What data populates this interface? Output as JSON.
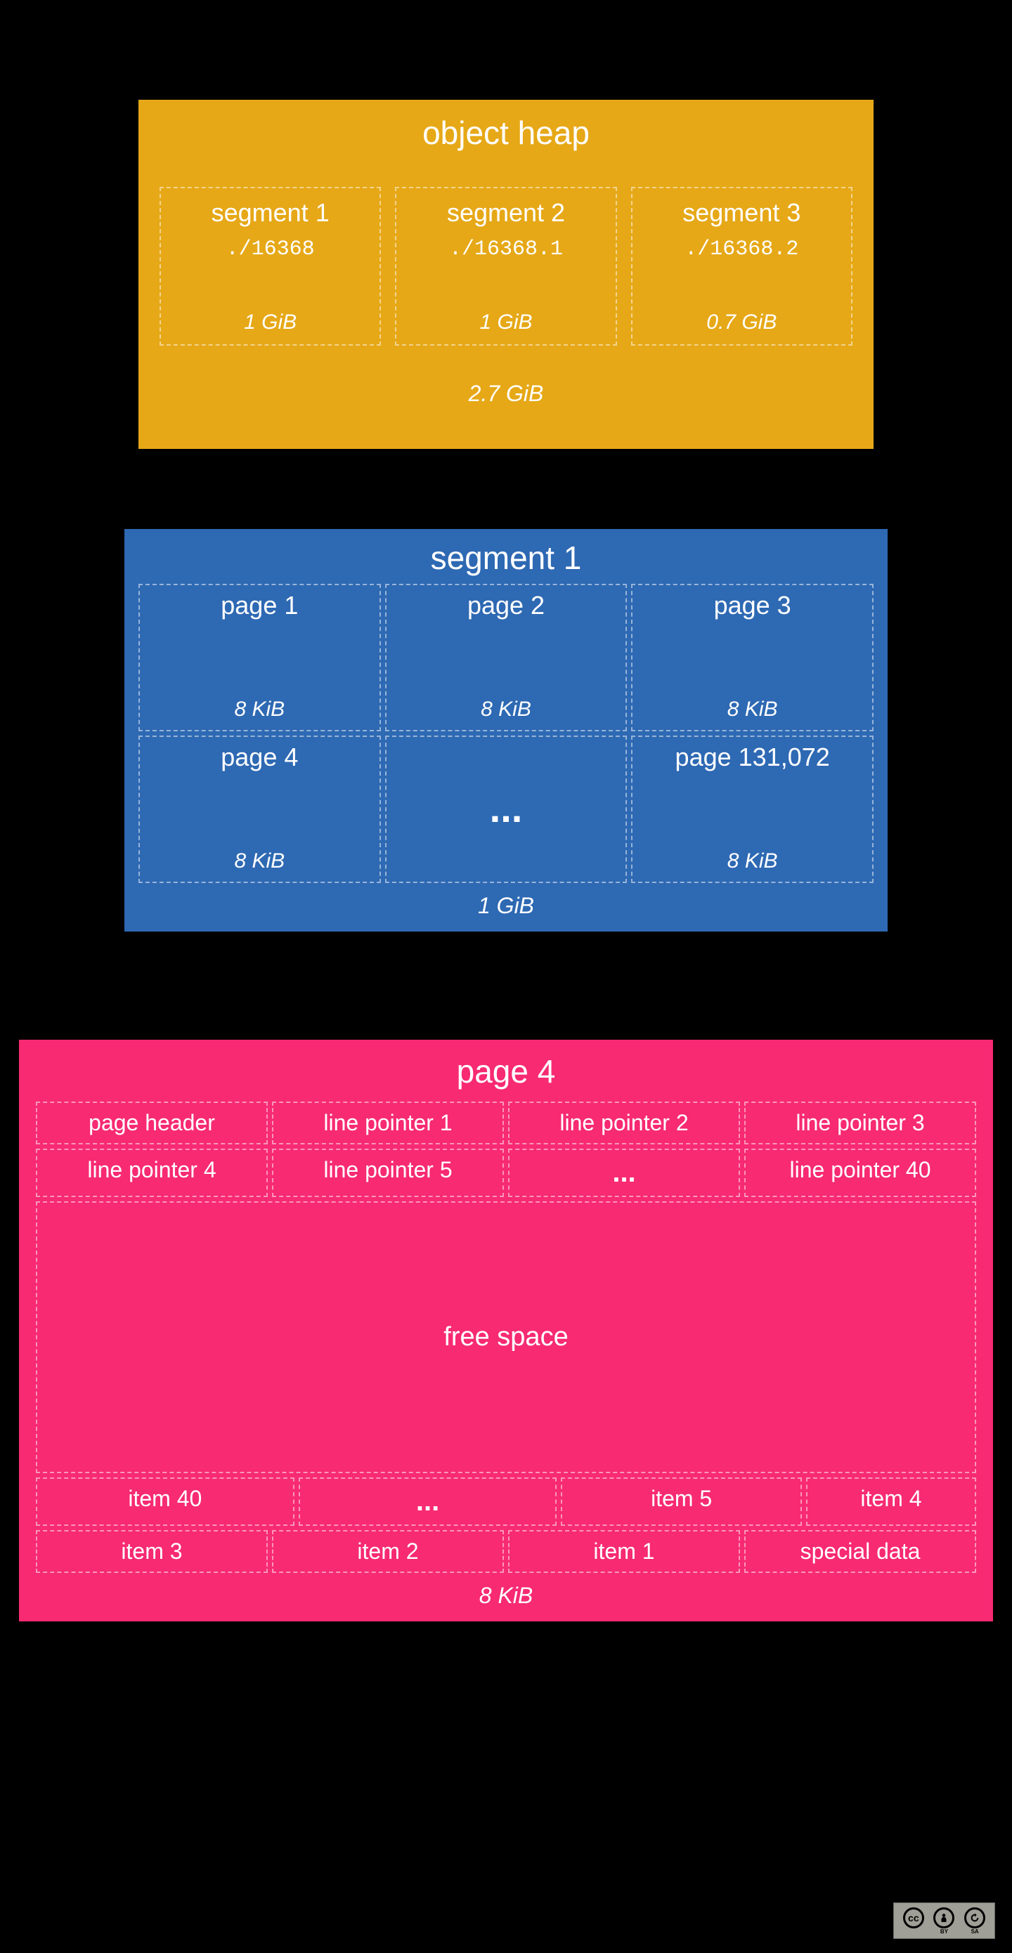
{
  "heap": {
    "title": "object heap",
    "segments": [
      {
        "name": "segment 1",
        "path": "./16368",
        "size": "1 GiB"
      },
      {
        "name": "segment 2",
        "path": "./16368.1",
        "size": "1 GiB"
      },
      {
        "name": "segment 3",
        "path": "./16368.2",
        "size": "0.7 GiB"
      }
    ],
    "total": "2.7 GiB"
  },
  "segment": {
    "title": "segment 1",
    "pages_row1": [
      {
        "name": "page 1",
        "size": "8 KiB"
      },
      {
        "name": "page 2",
        "size": "8 KiB"
      },
      {
        "name": "page 3",
        "size": "8 KiB"
      }
    ],
    "pages_row2": [
      {
        "name": "page 4",
        "size": "8 KiB"
      },
      {
        "ellipsis": "..."
      },
      {
        "name": "page 131,072",
        "size": "8 KiB"
      }
    ],
    "total": "1 GiB"
  },
  "page4": {
    "title": "page 4",
    "row1": [
      "page header",
      "line pointer 1",
      "line pointer 2",
      "line pointer 3"
    ],
    "row2": [
      "line pointer 4",
      "line pointer 5",
      "...",
      "line pointer 40"
    ],
    "free": "free space",
    "items_a": [
      "item 40",
      "...",
      "item 5",
      "item 4"
    ],
    "items_b": [
      "item 3",
      "item 2",
      "item 1",
      "special data"
    ],
    "total": "8 KiB"
  },
  "license": {
    "cc": "cc",
    "by": "BY",
    "sa": "SA"
  }
}
